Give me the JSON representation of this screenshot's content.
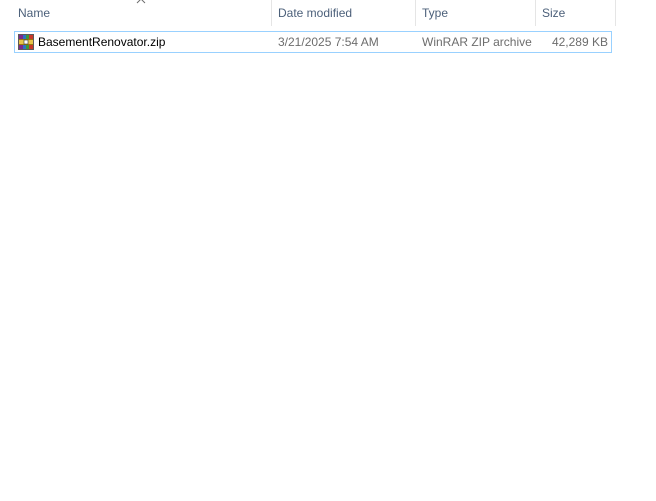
{
  "columns": {
    "name": "Name",
    "date_modified": "Date modified",
    "type": "Type",
    "size": "Size"
  },
  "sort": {
    "column": "name",
    "direction": "ascending",
    "icon": "chevron-up-icon"
  },
  "files": [
    {
      "name": "BasementRenovator.zip",
      "date_modified": "3/21/2025 7:54 AM",
      "type": "WinRAR ZIP archive",
      "size": "42,289 KB",
      "icon": "winrar-archive-icon",
      "selected": true
    }
  ],
  "colors": {
    "header_text": "#4c607a",
    "detail_text": "#6d6d6d",
    "row_focus_border": "#99d1ff"
  }
}
